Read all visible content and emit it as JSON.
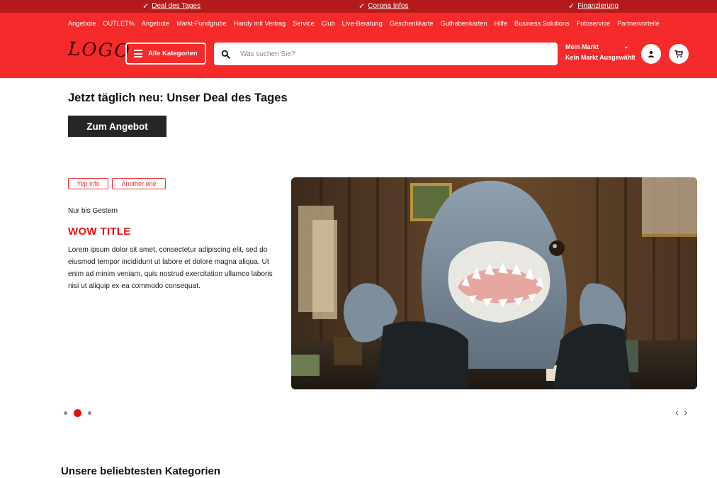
{
  "topbar": {
    "items": [
      {
        "label": "Deal des Tages"
      },
      {
        "label": "Corona Infos"
      },
      {
        "label": "Finanzierung"
      }
    ]
  },
  "nav": {
    "links": [
      "Angebote",
      "OUTLET%",
      "Angebote",
      "Markt-Fundgrube",
      "Handy mit Vertrag",
      "Service",
      "Club",
      "Live-Beratung",
      "Geschenkkarte",
      "Guthabenkarten",
      "Hilfe",
      "Business Solutions",
      "Fotoservice",
      "Partnervorteile"
    ]
  },
  "header": {
    "logo": "LOGO",
    "categories_label": "Alle Kategorien",
    "search_placeholder": "Was suchen Sie?",
    "market_title": "Mein Markt",
    "market_subtitle": "Kein Markt Ausgewählt"
  },
  "deal": {
    "title": "Jetzt täglich neu: Unser Deal des Tages",
    "button": "Zum Angebot"
  },
  "slide": {
    "tags": [
      "Yep info",
      "Another one"
    ],
    "kicker": "Nur bis Gestern",
    "title": "WOW TITLE",
    "description": "Lorem ipsum dolor sit amet, consectetur adipiscing elit, sed do eiusmod tempor incididunt ut labore et dolore magna aliqua. Ut enim ad minim veniam, quis nostrud exercitation ullamco laboris nisi ut aliquip ex ea commodo consequat."
  },
  "carousel": {
    "active_index": 1,
    "prev": "‹",
    "next": "›"
  },
  "categories": {
    "title": "Unsere beliebtesten Kategorien"
  },
  "colors": {
    "brand_red": "#f52a2a",
    "topbar_red": "#b51a1a",
    "accent_red": "#e51010",
    "dark_button": "#262626"
  }
}
